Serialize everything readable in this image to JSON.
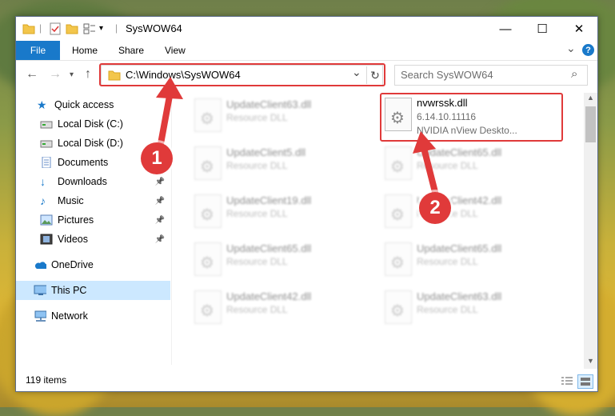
{
  "window": {
    "title": "SysWOW64",
    "controls": {
      "minimize": "—",
      "maximize": "☐",
      "close": "✕"
    }
  },
  "ribbon": {
    "file_label": "File",
    "tabs": [
      "Home",
      "Share",
      "View"
    ],
    "expand_icon": "⌄",
    "help_icon": "?"
  },
  "address_bar": {
    "path": "C:\\Windows\\SysWOW64",
    "dropdown_icon": "⌄",
    "refresh_icon": "↻"
  },
  "search": {
    "placeholder": "Search SysWOW64",
    "icon": "⌕"
  },
  "sidebar": {
    "items": [
      {
        "label": "Quick access",
        "icon": "star-icon",
        "pinned": false
      },
      {
        "label": "Local Disk (C:)",
        "icon": "drive-icon",
        "pinned": false
      },
      {
        "label": "Local Disk (D:)",
        "icon": "drive-icon",
        "pinned": false
      },
      {
        "label": "Documents",
        "icon": "document-icon",
        "pinned": false
      },
      {
        "label": "Downloads",
        "icon": "download-icon",
        "pinned": true
      },
      {
        "label": "Music",
        "icon": "music-icon",
        "pinned": true
      },
      {
        "label": "Pictures",
        "icon": "picture-icon",
        "pinned": true
      },
      {
        "label": "Videos",
        "icon": "video-icon",
        "pinned": true
      },
      {
        "label": "OneDrive",
        "icon": "cloud-icon",
        "pinned": false
      },
      {
        "label": "This PC",
        "icon": "computer-icon",
        "pinned": false,
        "selected": true
      },
      {
        "label": "Network",
        "icon": "network-icon",
        "pinned": false
      }
    ],
    "pin_glyph": "📌"
  },
  "files": {
    "highlighted": {
      "name": "nvwrssk.dll",
      "version": "6.14.10.11116",
      "description": "NVIDIA nView Deskto..."
    },
    "blurred": [
      {
        "name": "UpdateClient63.dll",
        "type": "Resource DLL"
      },
      {
        "name": "UpdateClient5.dll",
        "type": "Resource DLL"
      },
      {
        "name": "UpdateClient65.dll",
        "type": "Resource DLL"
      },
      {
        "name": "UpdateClient19.dll",
        "type": "Resource DLL"
      },
      {
        "name": "UpdateClient42.dll",
        "type": "Resource DLL"
      },
      {
        "name": "UpdateClient65.dll",
        "type": "Resource DLL"
      },
      {
        "name": "UpdateClient65.dll",
        "type": "Resource DLL"
      },
      {
        "name": "UpdateClient42.dll",
        "type": "Resource DLL"
      },
      {
        "name": "UpdateClient63.dll",
        "type": "Resource DLL"
      }
    ]
  },
  "status": {
    "item_count": "119 items"
  },
  "annotations": {
    "step1": "1",
    "step2": "2",
    "color": "#e03a3a"
  }
}
